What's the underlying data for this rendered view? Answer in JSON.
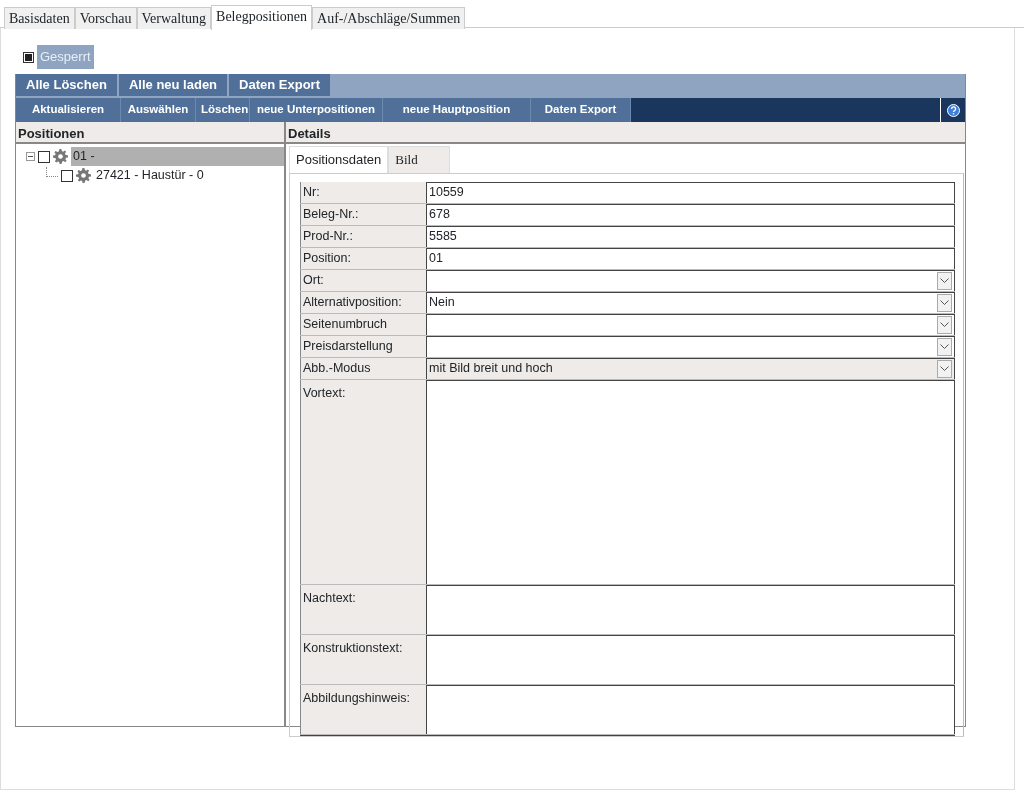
{
  "tabs": [
    {
      "label": "Basisdaten",
      "selected": false
    },
    {
      "label": "Vorschau",
      "selected": false
    },
    {
      "label": "Verwaltung",
      "selected": false
    },
    {
      "label": "Belegpositionen",
      "selected": true
    },
    {
      "label": "Auf-/Abschläge/Summen",
      "selected": false
    }
  ],
  "locked": {
    "label": "Gesperrt",
    "checked": true
  },
  "toolbar_1": [
    "Alle Löschen",
    "Alle neu laden",
    "Daten Export"
  ],
  "toolbar_2": [
    "Aktualisieren",
    "Auswählen",
    "Löschen",
    "neue Unterpositionen",
    "neue Hauptposition",
    "Daten Export"
  ],
  "positions": {
    "title": "Positionen",
    "tree": [
      {
        "label": "01 -",
        "checked": false,
        "selected": true,
        "expanded": true,
        "children": [
          {
            "label": "27421 - Haustür - 0",
            "checked": false,
            "selected": false
          }
        ]
      }
    ]
  },
  "details": {
    "title": "Details",
    "tabs": [
      {
        "label": "Positionsdaten",
        "selected": true
      },
      {
        "label": "Bild",
        "selected": false
      }
    ],
    "fields": [
      {
        "label": "Nr:",
        "kind": "text",
        "value": "10559",
        "disabled": false
      },
      {
        "label": "Beleg-Nr.:",
        "kind": "text",
        "value": "678",
        "disabled": false
      },
      {
        "label": "Prod-Nr.:",
        "kind": "text",
        "value": "5585",
        "disabled": false
      },
      {
        "label": "Position:",
        "kind": "text",
        "value": "01",
        "disabled": false
      },
      {
        "label": "Ort:",
        "kind": "select",
        "disabled": false
      },
      {
        "label": "Alternativposition:",
        "kind": "select",
        "value": "Nein",
        "disabled": false
      },
      {
        "label": "Seitenumbruch",
        "kind": "select",
        "disabled": false
      },
      {
        "label": "Preisdarstellung",
        "kind": "select",
        "disabled": false
      },
      {
        "label": "Abb.-Modus",
        "kind": "select",
        "value": "mit Bild breit und hoch",
        "disabled": true
      },
      {
        "label": "Vortext:",
        "kind": "textarea_large",
        "disabled": false
      },
      {
        "label": "Nachtext:",
        "kind": "textarea",
        "disabled": false
      },
      {
        "label": "Konstruktionstext:",
        "kind": "textarea",
        "disabled": false
      },
      {
        "label": "Abbildungshinweis:",
        "kind": "textarea",
        "disabled": false
      }
    ]
  }
}
